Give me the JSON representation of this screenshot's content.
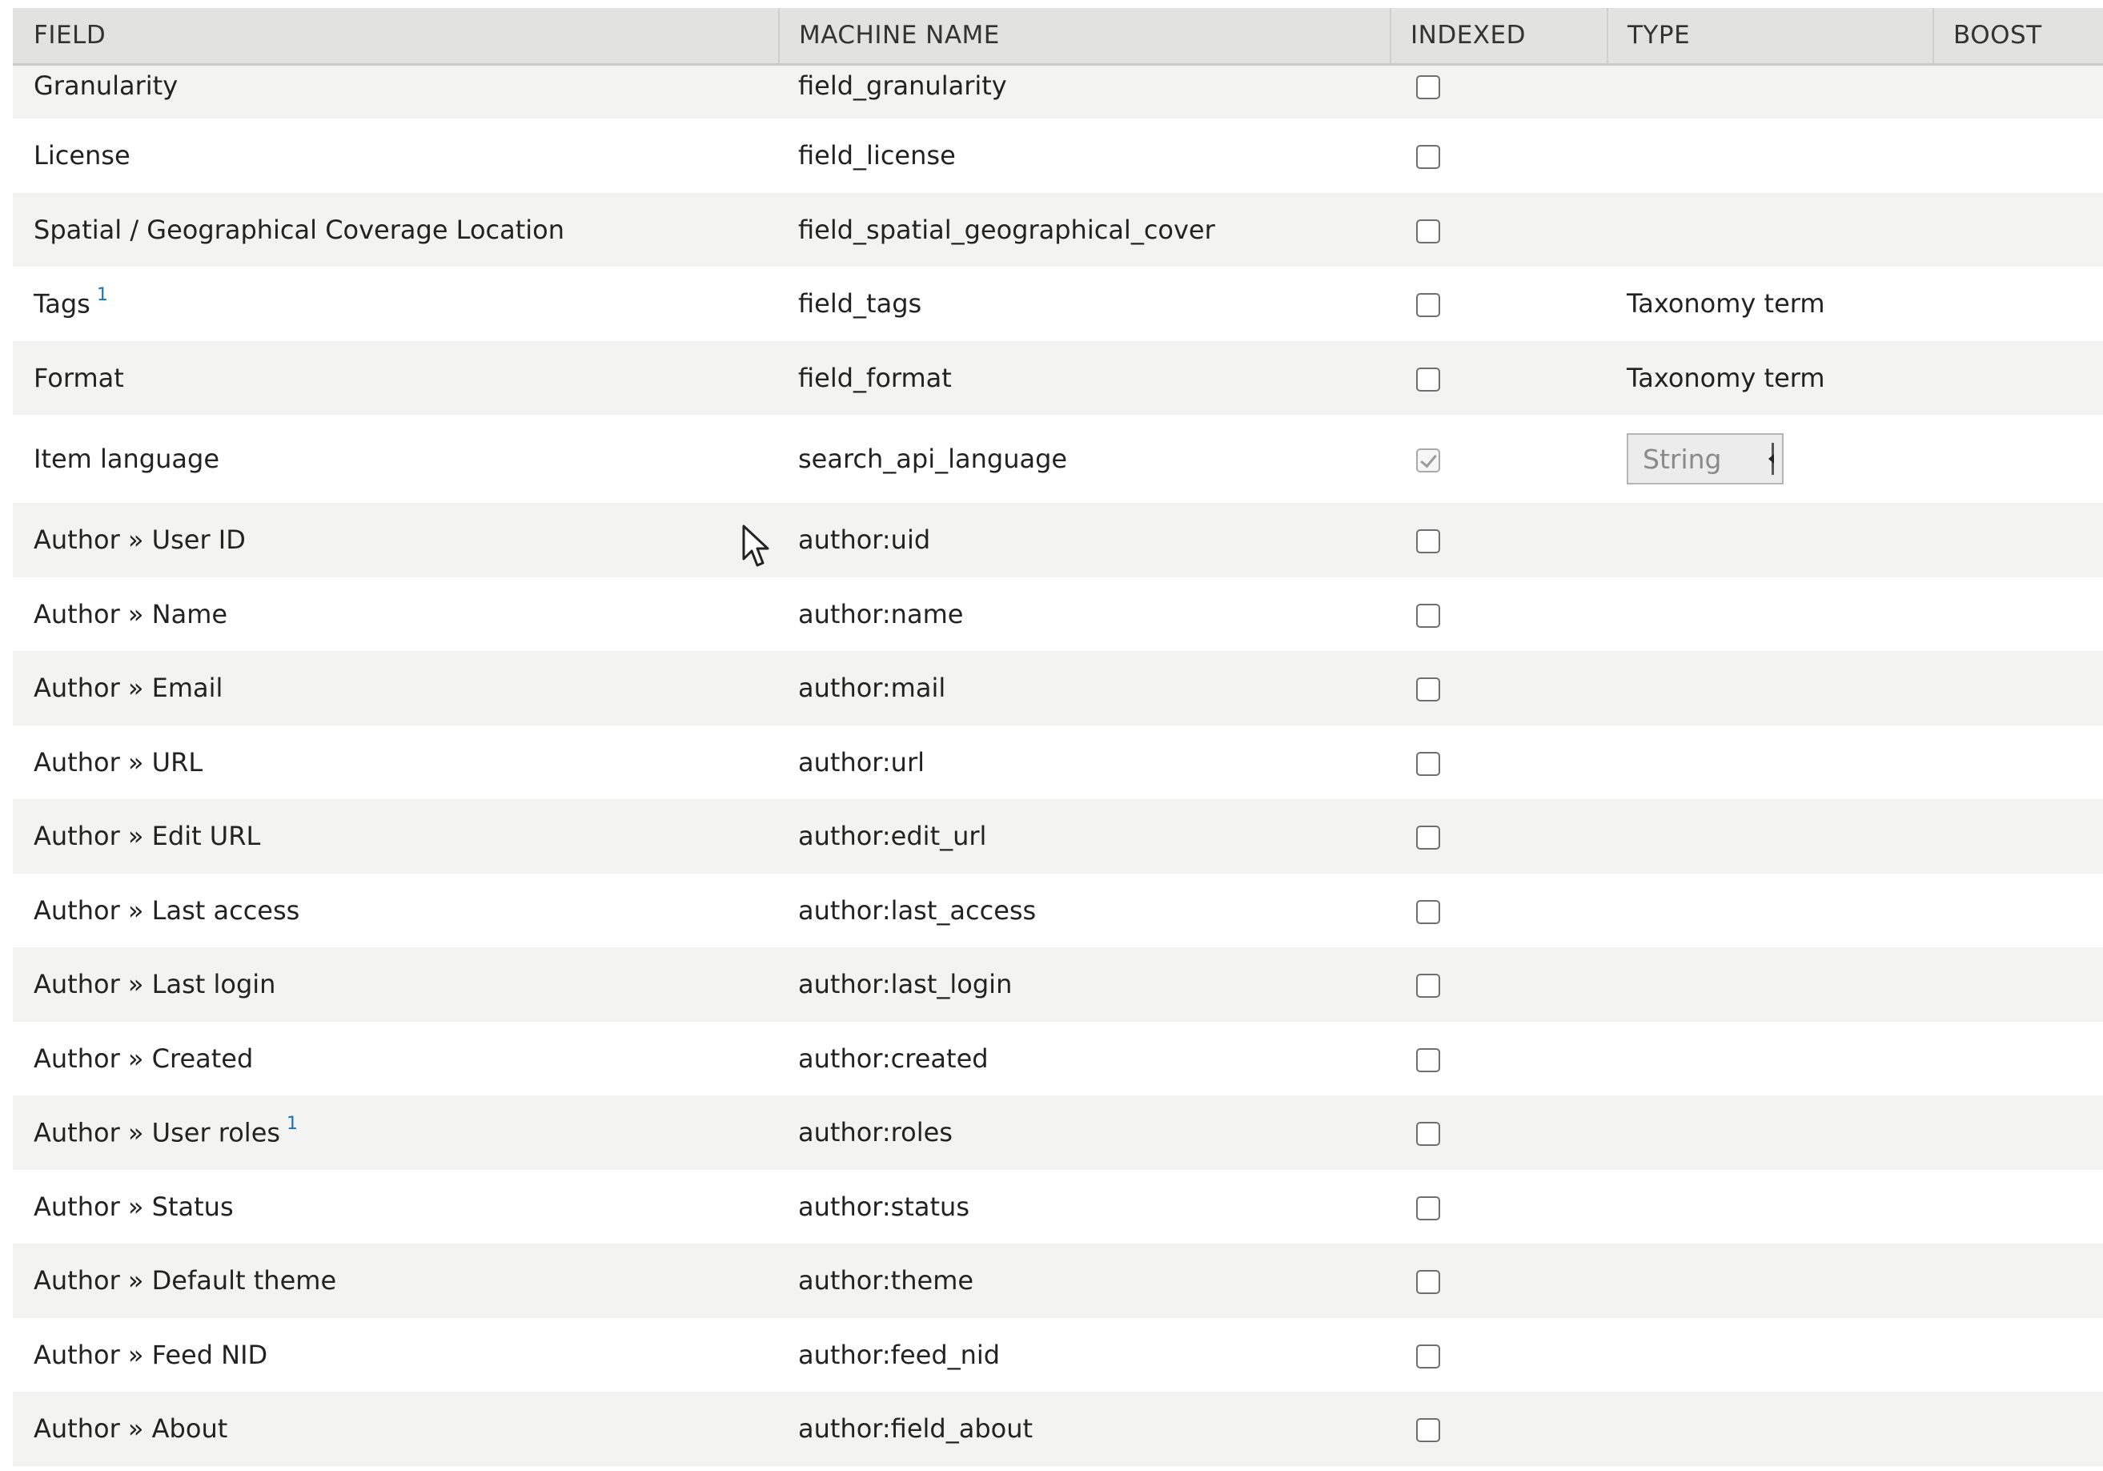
{
  "table": {
    "headers": {
      "field": "FIELD",
      "machine_name": "MACHINE NAME",
      "indexed": "INDEXED",
      "type": "TYPE",
      "boost": "BOOST"
    },
    "rows": [
      {
        "field": "Granularity",
        "machine": "field_granularity",
        "indexed": false,
        "type": ""
      },
      {
        "field": "License",
        "machine": "field_license",
        "indexed": false,
        "type": ""
      },
      {
        "field": "Spatial / Geographical Coverage Location",
        "machine": "field_spatial_geographical_cover",
        "indexed": false,
        "type": ""
      },
      {
        "field": "Tags",
        "sup": "1",
        "machine": "field_tags",
        "indexed": false,
        "type": "Taxonomy term"
      },
      {
        "field": "Format",
        "machine": "field_format",
        "indexed": false,
        "type": "Taxonomy term"
      },
      {
        "field": "Item language",
        "machine": "search_api_language",
        "indexed": true,
        "type": "",
        "select_value": "String"
      },
      {
        "field": "Author » User ID",
        "machine": "author:uid",
        "indexed": false,
        "type": ""
      },
      {
        "field": "Author » Name",
        "machine": "author:name",
        "indexed": false,
        "type": ""
      },
      {
        "field": "Author » Email",
        "machine": "author:mail",
        "indexed": false,
        "type": ""
      },
      {
        "field": "Author » URL",
        "machine": "author:url",
        "indexed": false,
        "type": ""
      },
      {
        "field": "Author » Edit URL",
        "machine": "author:edit_url",
        "indexed": false,
        "type": ""
      },
      {
        "field": "Author » Last access",
        "machine": "author:last_access",
        "indexed": false,
        "type": ""
      },
      {
        "field": "Author » Last login",
        "machine": "author:last_login",
        "indexed": false,
        "type": ""
      },
      {
        "field": "Author » Created",
        "machine": "author:created",
        "indexed": false,
        "type": ""
      },
      {
        "field": "Author » User roles",
        "sup": "1",
        "machine": "author:roles",
        "indexed": false,
        "type": ""
      },
      {
        "field": "Author » Status",
        "machine": "author:status",
        "indexed": false,
        "type": ""
      },
      {
        "field": "Author » Default theme",
        "machine": "author:theme",
        "indexed": false,
        "type": ""
      },
      {
        "field": "Author » Feed NID",
        "machine": "author:feed_nid",
        "indexed": false,
        "type": ""
      },
      {
        "field": "Author » About",
        "machine": "author:field_about",
        "indexed": false,
        "type": ""
      }
    ]
  },
  "icons": {
    "cursor": "mouse-pointer-icon",
    "select_arrow": "chevron-down-icon",
    "checkmark": "checkmark-icon"
  },
  "colors": {
    "header_bg": "#e2e2e0",
    "row_alt_bg": "#f3f3f2",
    "footnote_link": "#1a73b5"
  }
}
